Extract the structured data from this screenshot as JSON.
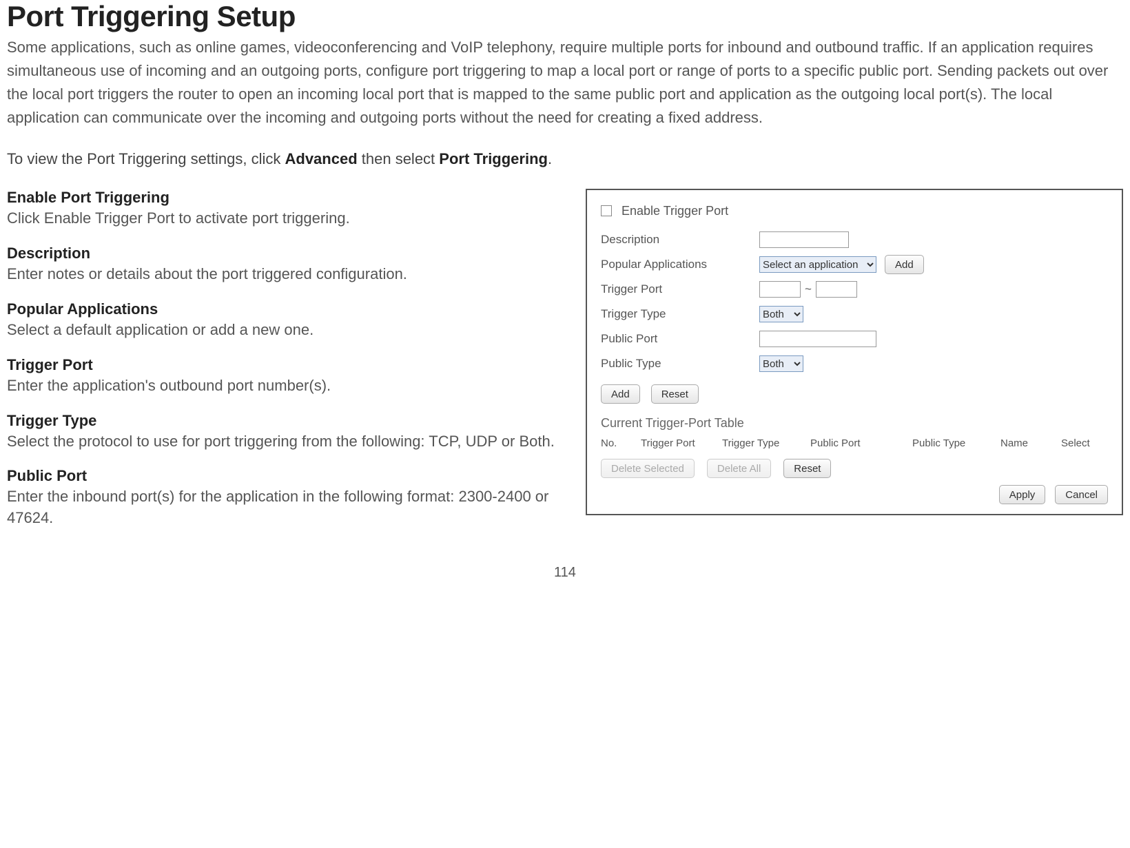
{
  "page_number": "114",
  "title": "Port Triggering Setup",
  "intro": "Some applications, such as online games, videoconferencing and VoIP telephony, require multiple ports for inbound and outbound traffic. If an application requires simultaneous use of incoming and an outgoing ports, configure port triggering to map a local port or range of ports to a specific public port. Sending packets out over the local port triggers the router to open an incoming local port that is mapped to the same public port and application as the outgoing local port(s). The local application can communicate over the incoming and outgoing ports without the need for creating a fixed address.",
  "nav": {
    "prefix": "To view the Port Triggering settings, click ",
    "link1": "Advanced",
    "mid": " then select ",
    "link2": "Port Triggering",
    "suffix": "."
  },
  "defs": [
    {
      "term": "Enable Port Triggering",
      "desc": "Click Enable Trigger Port to activate port triggering."
    },
    {
      "term": "Description",
      "desc": "Enter notes or details about the port triggered configuration."
    },
    {
      "term": "Popular Applications",
      "desc": "Select a default application or add a new one."
    },
    {
      "term": "Trigger Port",
      "desc": "Enter the application's outbound port number(s)."
    },
    {
      "term": "Trigger Type",
      "desc": "Select the protocol to use for port triggering from the following: TCP, UDP or Both."
    },
    {
      "term": "Public Port",
      "desc": "Enter the inbound port(s) for the application in the following format: 2300-2400 or 47624."
    }
  ],
  "panel": {
    "enable_label": "Enable Trigger Port",
    "labels": {
      "description": "Description",
      "popular_apps": "Popular Applications",
      "trigger_port": "Trigger Port",
      "trigger_type": "Trigger Type",
      "public_port": "Public Port",
      "public_type": "Public Type"
    },
    "app_select": "Select an application",
    "type_select": "Both",
    "add_small": "Add",
    "add_btn": "Add",
    "reset_btn": "Reset",
    "table_title": "Current Trigger-Port Table",
    "table_headers": [
      "No.",
      "Trigger Port",
      "Trigger Type",
      "Public Port",
      "Public Type",
      "Name",
      "Select"
    ],
    "delete_selected": "Delete Selected",
    "delete_all": "Delete All",
    "reset2": "Reset",
    "apply": "Apply",
    "cancel": "Cancel"
  }
}
